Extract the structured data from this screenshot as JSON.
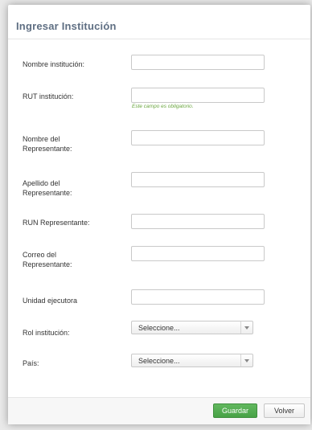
{
  "modal": {
    "title": "Ingresar Institución"
  },
  "form": {
    "nombre_institucion": {
      "label": "Nombre institución:",
      "value": ""
    },
    "rut_institucion": {
      "label": "RUT institución:",
      "value": "",
      "error": "Este campo es obligatorio."
    },
    "nombre_representante": {
      "label": "Nombre del Representante:",
      "value": ""
    },
    "apellido_representante": {
      "label": "Apellido del Representante:",
      "value": ""
    },
    "run_representante": {
      "label": "RUN Representante:",
      "value": ""
    },
    "correo_representante": {
      "label": "Correo del Representante:",
      "value": ""
    },
    "unidad_ejecutora": {
      "label": "Unidad ejecutora",
      "value": ""
    },
    "rol_institucion": {
      "label": "Rol institución:",
      "selected": "Seleccione..."
    },
    "pais": {
      "label": "País:",
      "selected": "Seleccione..."
    }
  },
  "footer": {
    "save_label": "Guardar",
    "back_label": "Volver"
  },
  "colors": {
    "title": "#5f6f83",
    "hint": "#6aa63f",
    "save_button": "#4cab4a"
  },
  "icons": {
    "select_arrow": "chevron-down-icon"
  }
}
